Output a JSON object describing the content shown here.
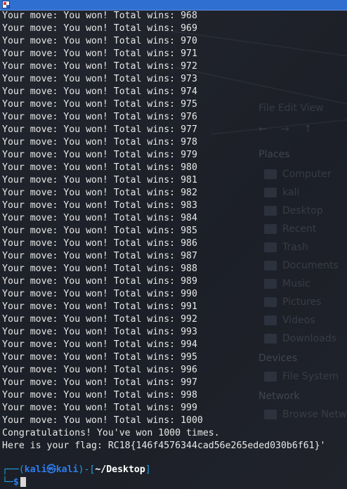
{
  "background_panel": {
    "title": "File Edit View",
    "nav": "← → ↑",
    "sections": [
      {
        "label": "Places",
        "items": [
          "Computer",
          "kali",
          "Desktop",
          "Recent",
          "Trash",
          "Documents",
          "Music",
          "Pictures",
          "Videos",
          "Downloads"
        ]
      },
      {
        "label": "Devices",
        "items": [
          "File System"
        ]
      },
      {
        "label": "Network",
        "items": [
          "Browse Netw"
        ]
      }
    ]
  },
  "terminal": {
    "lines": [
      "Your move: You won! Total wins: 968",
      "Your move: You won! Total wins: 969",
      "Your move: You won! Total wins: 970",
      "Your move: You won! Total wins: 971",
      "Your move: You won! Total wins: 972",
      "Your move: You won! Total wins: 973",
      "Your move: You won! Total wins: 974",
      "Your move: You won! Total wins: 975",
      "Your move: You won! Total wins: 976",
      "Your move: You won! Total wins: 977",
      "Your move: You won! Total wins: 978",
      "Your move: You won! Total wins: 979",
      "Your move: You won! Total wins: 980",
      "Your move: You won! Total wins: 981",
      "Your move: You won! Total wins: 982",
      "Your move: You won! Total wins: 983",
      "Your move: You won! Total wins: 984",
      "Your move: You won! Total wins: 985",
      "Your move: You won! Total wins: 986",
      "Your move: You won! Total wins: 987",
      "Your move: You won! Total wins: 988",
      "Your move: You won! Total wins: 989",
      "Your move: You won! Total wins: 990",
      "Your move: You won! Total wins: 991",
      "Your move: You won! Total wins: 992",
      "Your move: You won! Total wins: 993",
      "Your move: You won! Total wins: 994",
      "Your move: You won! Total wins: 995",
      "Your move: You won! Total wins: 996",
      "Your move: You won! Total wins: 997",
      "Your move: You won! Total wins: 998",
      "Your move: You won! Total wins: 999",
      "Your move: You won! Total wins: 1000",
      "Congratulations! You've won 1000 times.",
      "Here is your flag: RC18{146f4576344cad56e265eded030b6f61}'"
    ],
    "prompt": {
      "top_left": "┌──(",
      "user": "kali㉿kali",
      "mid": ")-[",
      "path": "~/Desktop",
      "end": "]",
      "bottom_left": "└─",
      "dollar": "$"
    }
  },
  "colors": {
    "text": "#e8e8e8",
    "prompt_frame": "#1ea0e0",
    "prompt_user": "#2c7cf0",
    "topbar": "#2f6fd1"
  }
}
